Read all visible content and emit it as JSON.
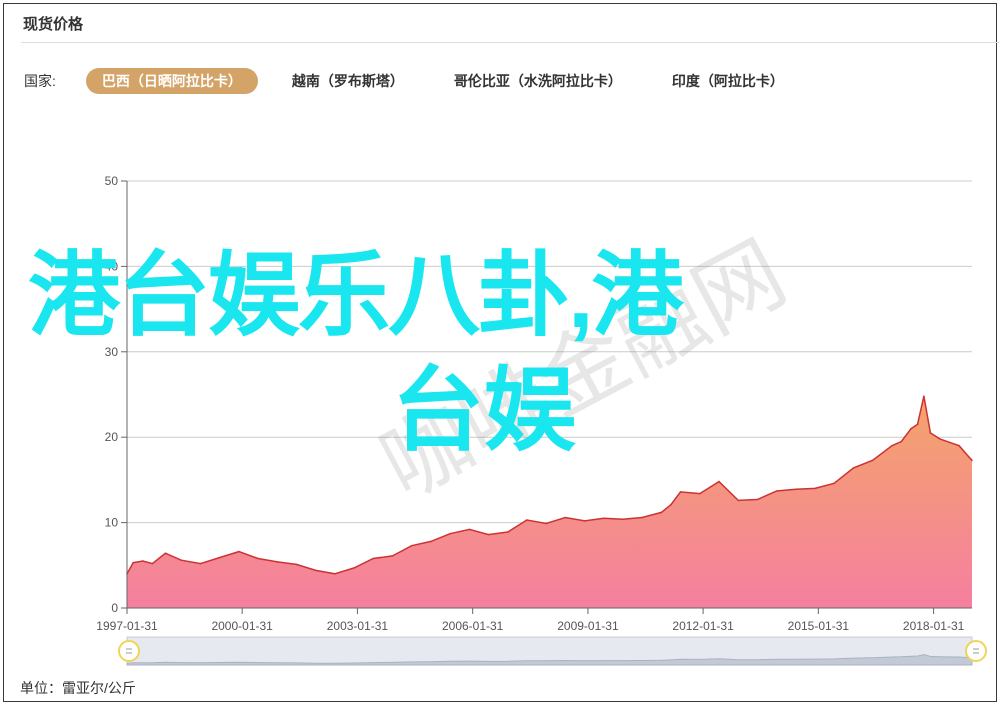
{
  "header": {
    "title": "现货价格"
  },
  "filter": {
    "label": "国家:",
    "tabs": [
      {
        "label": "巴西（日晒阿拉比卡）",
        "active": true
      },
      {
        "label": "越南（罗布斯塔）",
        "active": false
      },
      {
        "label": "哥伦比亚（水洗阿拉比卡）",
        "active": false
      },
      {
        "label": "印度（阿拉比卡）",
        "active": false
      }
    ]
  },
  "footer": {
    "unit": "单位：雷亚尔/公斤"
  },
  "overlay": {
    "line1": "港台娱乐八卦,港",
    "line2": "台娱"
  },
  "watermark": {
    "text": "咖啡金融网"
  },
  "colors": {
    "accent": "#d4a367",
    "line": "#cc3333",
    "fill_top": "#f4a46a",
    "fill_bottom": "#f57fa0",
    "overlay": "#1ae6ef"
  },
  "chart_data": {
    "type": "area",
    "title": "",
    "xlabel": "",
    "ylabel": "",
    "ylim": [
      0,
      50
    ],
    "yticks": [
      0,
      10,
      20,
      30,
      40,
      50
    ],
    "xticks": [
      "1997-01-31",
      "2000-01-31",
      "2003-01-31",
      "2006-01-31",
      "2009-01-31",
      "2012-01-31",
      "2015-01-31",
      "2018-01-31"
    ],
    "grid": true,
    "x": [
      "1997-01-31",
      "1997-03-31",
      "1997-06-30",
      "1997-09-30",
      "1998-01-31",
      "1998-06-30",
      "1998-12-31",
      "1999-06-30",
      "1999-12-31",
      "2000-06-30",
      "2000-12-31",
      "2001-06-30",
      "2001-12-31",
      "2002-06-30",
      "2002-12-31",
      "2003-06-30",
      "2003-12-31",
      "2004-06-30",
      "2004-12-31",
      "2005-06-30",
      "2005-12-31",
      "2006-06-30",
      "2006-12-31",
      "2007-06-30",
      "2007-12-31",
      "2008-06-30",
      "2008-12-31",
      "2009-06-30",
      "2009-12-31",
      "2010-06-30",
      "2010-12-31",
      "2011-03-31",
      "2011-06-30",
      "2011-12-31",
      "2012-06-30",
      "2012-12-31",
      "2013-06-30",
      "2013-12-31",
      "2014-06-30",
      "2014-12-31",
      "2015-06-30",
      "2015-12-31",
      "2016-06-30",
      "2016-12-31",
      "2017-03-31",
      "2017-06-30",
      "2017-08-31",
      "2017-10-31",
      "2017-12-31",
      "2018-03-31",
      "2018-06-30",
      "2018-09-30",
      "2018-12-31",
      "2019-01-31"
    ],
    "series": [
      {
        "values": [
          4.0,
          5.3,
          5.5,
          5.2,
          6.4,
          5.6,
          5.2,
          5.9,
          6.6,
          5.8,
          5.4,
          5.1,
          4.4,
          4.0,
          4.7,
          5.8,
          6.1,
          7.3,
          7.8,
          8.7,
          9.2,
          8.6,
          8.9,
          10.3,
          9.9,
          10.6,
          10.2,
          10.5,
          10.4,
          10.6,
          11.2,
          12.1,
          13.6,
          13.4,
          14.8,
          12.6,
          12.7,
          13.7,
          13.9,
          14.0,
          14.6,
          16.4,
          17.3,
          19.0,
          19.5,
          21.0,
          21.5,
          24.8,
          20.5,
          19.8,
          19.4,
          19.0,
          17.7,
          17.3
        ]
      }
    ]
  }
}
